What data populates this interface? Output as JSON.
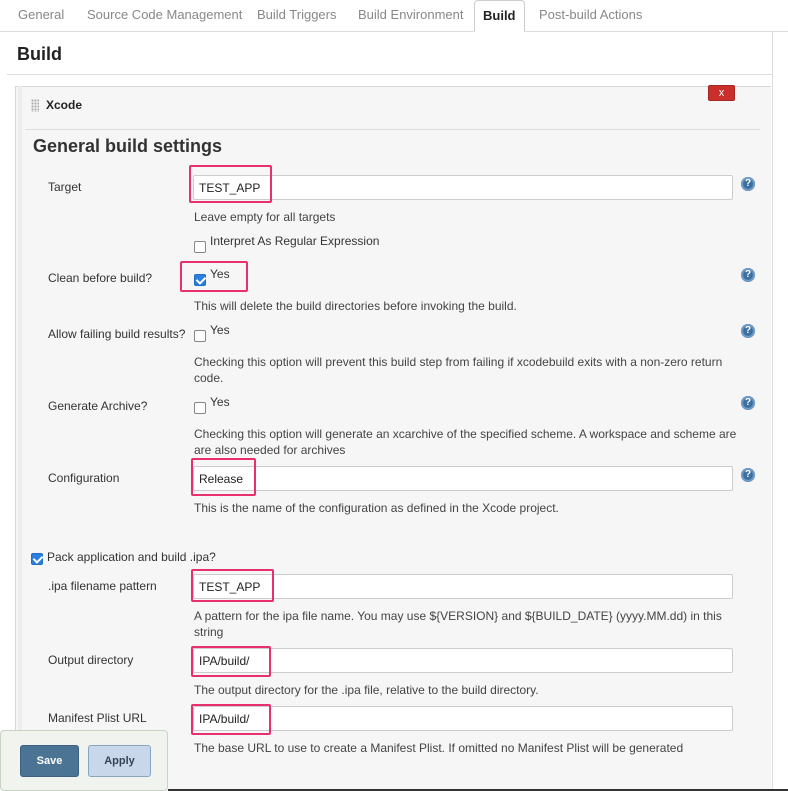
{
  "tabs": [
    {
      "label": "General"
    },
    {
      "label": "Source Code Management"
    },
    {
      "label": "Build Triggers"
    },
    {
      "label": "Build Environment"
    },
    {
      "label": "Build",
      "active": true
    },
    {
      "label": "Post-build Actions"
    }
  ],
  "section_title": "Build",
  "builder": {
    "title": "Xcode",
    "delete_label": "x",
    "subsection": "General build settings"
  },
  "fields": {
    "target": {
      "label": "Target",
      "value": "TEST_APP",
      "desc": "Leave empty for all targets"
    },
    "interpret_regex": {
      "label": "Interpret As Regular Expression",
      "checked": false
    },
    "clean": {
      "label": "Clean before build?",
      "option": "Yes",
      "checked": true,
      "desc": "This will delete the build directories before invoking the build."
    },
    "allow_failing": {
      "label": "Allow failing build results?",
      "option": "Yes",
      "checked": false,
      "desc": "Checking this option will prevent this build step from failing if xcodebuild exits with a non-zero return code."
    },
    "generate_archive": {
      "label": "Generate Archive?",
      "option": "Yes",
      "checked": false,
      "desc": "Checking this option will generate an xcarchive of the specified scheme. A workspace and scheme are are also needed for archives"
    },
    "configuration": {
      "label": "Configuration",
      "value": "Release",
      "desc": "This is the name of the configuration as defined in the Xcode project."
    },
    "pack_ipa": {
      "label": "Pack application and build .ipa?",
      "checked": true
    },
    "ipa_pattern": {
      "label": ".ipa filename pattern",
      "value": "TEST_APP",
      "desc": "A pattern for the ipa file name. You may use ${VERSION} and ${BUILD_DATE} (yyyy.MM.dd) in this string"
    },
    "output_dir": {
      "label": "Output directory",
      "value": "IPA/build/",
      "desc": "The output directory for the .ipa file, relative to the build directory."
    },
    "manifest_url": {
      "label": "Manifest Plist URL",
      "value": "IPA/build/",
      "desc": "The base URL to use to create a Manifest Plist. If omitted no Manifest Plist will be generated"
    }
  },
  "help_icon": "question-mark-help-icon",
  "buttons": {
    "save": "Save",
    "apply": "Apply"
  },
  "colors": {
    "highlight": "#e8306e",
    "checkbox": "#2a7fdd",
    "delete": "#c9302c",
    "save": "#4a7394"
  }
}
